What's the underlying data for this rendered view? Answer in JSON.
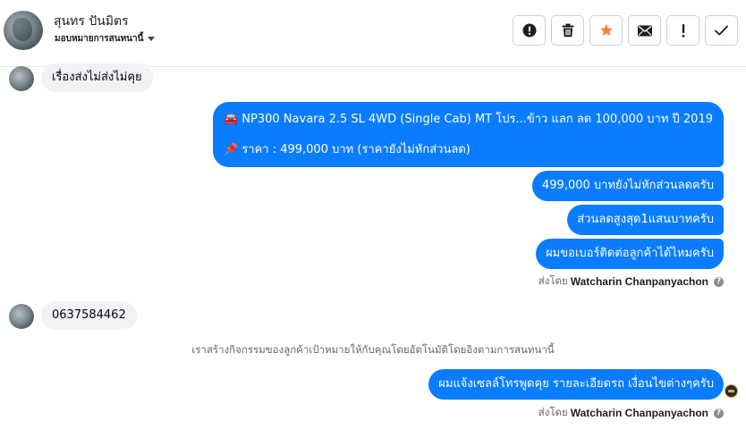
{
  "header": {
    "contact_name": "สุนทร ปันมิตร",
    "assign_label": "มอบหมายการสนทนานี้",
    "actions": [
      {
        "icon": "alert-circle-icon",
        "name": "mark-spam-button"
      },
      {
        "icon": "trash-icon",
        "name": "delete-button"
      },
      {
        "icon": "star-icon",
        "name": "star-button",
        "color": "#f5843b"
      },
      {
        "icon": "envelope-icon",
        "name": "mark-unread-button"
      },
      {
        "icon": "exclamation-icon",
        "name": "follow-up-button"
      },
      {
        "icon": "check-icon",
        "name": "mark-done-button"
      }
    ]
  },
  "messages": {
    "in_1": "เรื่องส่งไม่ส่งไม่คุย",
    "out_big_line1_emoji": "🚘",
    "out_big_line1": "NP300 Navara 2.5 SL 4WD (Single Cab) MT โปร...ข้าว แลก ลด 100,000 บาท ปี 2019",
    "out_big_line2_emoji": "📌",
    "out_big_line2": "ราคา : 499,000 บาท (ราคายังไม่หักส่วนลด)",
    "out_1": "499,000 บาทยังไม่หักส่วนลดครับ",
    "out_2": "ส่วนลดสูงสุด1แสนบาทครับ",
    "out_3": "ผมขอเบอร์ติดต่อลูกค้าได้ไหมครับ",
    "sent_by_prefix_1": "ส่งโดย",
    "sent_by_name_1": "Watcharin Chanpanyachon",
    "in_2": "0637584462",
    "system_note": "เราสร้างกิจกรรมของลูกค้าเป้าหมายให้กับคุณโดยอัตโนมัติโดยอิงตามการสนทนานี้",
    "out_4": "ผมแจ้งเซลล์โทรพูดคุย รายละเอียดรถ เงื่อนไขต่างๆครับ",
    "sent_by_prefix_2": "ส่งโดย",
    "sent_by_name_2": "Watcharin Chanpanyachon",
    "help_glyph": "?"
  },
  "colors": {
    "outgoing_bubble": "#0a7cff",
    "incoming_bubble": "#f0f2f5",
    "star": "#f5843b"
  }
}
